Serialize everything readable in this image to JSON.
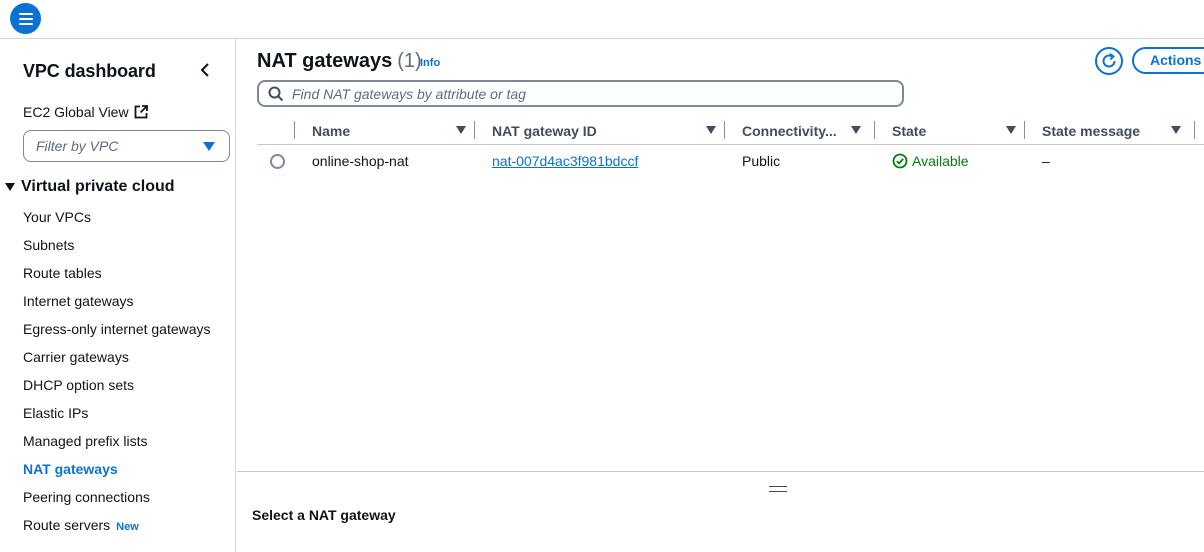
{
  "sidebar": {
    "title": "VPC dashboard",
    "ec2_global_view": "EC2 Global View",
    "filter_placeholder": "Filter by VPC",
    "section_title": "Virtual private cloud",
    "items": [
      {
        "label": "Your VPCs"
      },
      {
        "label": "Subnets"
      },
      {
        "label": "Route tables"
      },
      {
        "label": "Internet gateways"
      },
      {
        "label": "Egress-only internet gateways"
      },
      {
        "label": "Carrier gateways"
      },
      {
        "label": "DHCP option sets"
      },
      {
        "label": "Elastic IPs"
      },
      {
        "label": "Managed prefix lists"
      },
      {
        "label": "NAT gateways",
        "active": true
      },
      {
        "label": "Peering connections"
      },
      {
        "label": "Route servers",
        "badge": "New"
      }
    ]
  },
  "main": {
    "title": "NAT gateways",
    "count": "(1)",
    "info": "Info",
    "actions_label": "Actions",
    "search_placeholder": "Find NAT gateways by attribute or tag",
    "columns": [
      "Name",
      "NAT gateway ID",
      "Connectivity...",
      "State",
      "State message"
    ],
    "rows": [
      {
        "name": "online-shop-nat",
        "nat_gateway_id": "nat-007d4ac3f981bdccf",
        "connectivity": "Public",
        "state": "Available",
        "state_message": "–"
      }
    ]
  },
  "split_panel": {
    "title": "Select a NAT gateway"
  },
  "colors": {
    "accent": "#0972d3",
    "success": "#037f0c",
    "text": "#0f141a"
  }
}
